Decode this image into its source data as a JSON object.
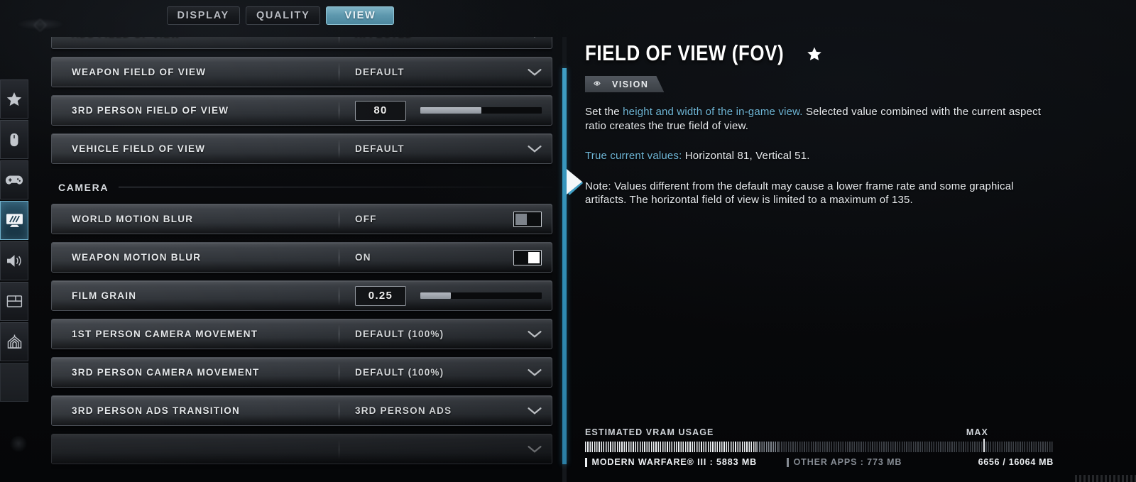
{
  "tabs": [
    {
      "label": "DISPLAY",
      "active": false
    },
    {
      "label": "QUALITY",
      "active": false
    },
    {
      "label": "VIEW",
      "active": true
    }
  ],
  "sidebar": {
    "items": [
      {
        "icon": "star-icon",
        "name": "favorites"
      },
      {
        "icon": "mouse-icon",
        "name": "mouse-keyboard"
      },
      {
        "icon": "gamepad-icon",
        "name": "controller"
      },
      {
        "icon": "monitor-icon",
        "name": "graphics",
        "active": true
      },
      {
        "icon": "speaker-icon",
        "name": "audio"
      },
      {
        "icon": "interface-icon",
        "name": "interface"
      },
      {
        "icon": "telemetry-icon",
        "name": "telemetry"
      },
      {
        "icon": "blank-icon",
        "name": "blank"
      }
    ]
  },
  "settings": [
    {
      "type": "dropdown",
      "label": "ADS FIELD OF VIEW",
      "value": "AFFECTED",
      "clipped": true
    },
    {
      "type": "dropdown",
      "label": "WEAPON FIELD OF VIEW",
      "value": "DEFAULT"
    },
    {
      "type": "slider",
      "label": "3RD PERSON FIELD OF VIEW",
      "value": "80",
      "fill_pct": 50
    },
    {
      "type": "dropdown",
      "label": "VEHICLE FIELD OF VIEW",
      "value": "DEFAULT"
    },
    {
      "type": "group",
      "label": "CAMERA"
    },
    {
      "type": "toggle",
      "label": "WORLD MOTION BLUR",
      "value": "OFF",
      "on": false
    },
    {
      "type": "toggle",
      "label": "WEAPON MOTION BLUR",
      "value": "ON",
      "on": true
    },
    {
      "type": "slider",
      "label": "FILM GRAIN",
      "value": "0.25",
      "fill_pct": 25
    },
    {
      "type": "dropdown",
      "label": "1ST PERSON CAMERA MOVEMENT",
      "value": "DEFAULT (100%)"
    },
    {
      "type": "dropdown",
      "label": "3RD PERSON CAMERA MOVEMENT",
      "value": "DEFAULT (100%)"
    },
    {
      "type": "dropdown",
      "label": "3RD PERSON ADS TRANSITION",
      "value": "3RD PERSON ADS"
    },
    {
      "type": "dropdown",
      "label": "",
      "value": "",
      "ghost": true
    }
  ],
  "info": {
    "title": "FIELD OF VIEW (FOV)",
    "favorite_star": "star-icon",
    "badge": {
      "icon": "eye-icon",
      "label": "VISION"
    },
    "paragraphs": [
      {
        "segments": [
          {
            "text": "Set the ",
            "highlight": false
          },
          {
            "text": "height and width of the in-game view.",
            "highlight": true
          },
          {
            "text": " Selected value combined with the current aspect ratio creates the true field of view.",
            "highlight": false
          }
        ]
      },
      {
        "segments": [
          {
            "text": "True current values:",
            "highlight": true
          },
          {
            "text": " Horizontal 81, Vertical 51.",
            "highlight": false
          }
        ]
      },
      {
        "segments": [
          {
            "text": "Note: Values different from the default may cause a lower frame rate and some graphical artifacts. The horizontal field of view is limited to a maximum of 135.",
            "highlight": false
          }
        ]
      }
    ]
  },
  "vram": {
    "heading": "ESTIMATED VRAM USAGE",
    "max_label": "MAX",
    "game_label": "MODERN WARFARE® III : 5883 MB",
    "other_label": "OTHER APPS : 773 MB",
    "total_label": "6656 / 16064 MB",
    "game_mb": 5883,
    "other_mb": 773,
    "used_mb": 6656,
    "total_mb": 16064,
    "max_mark_pct": 85
  },
  "colors": {
    "accent_blue": "#2f8cb4",
    "tab_active": "#5e98ae",
    "link_blue": "#6fb6d6",
    "row_top": "#4b4f55",
    "text": "#e4e7ea"
  }
}
